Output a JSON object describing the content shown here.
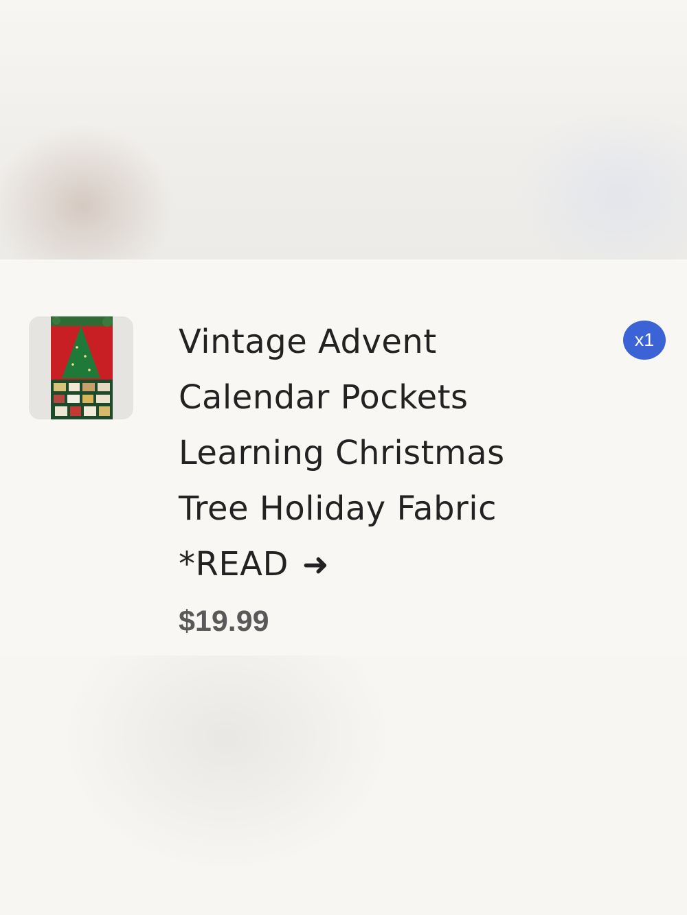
{
  "product": {
    "title": "Vintage Advent\nCalendar Pockets\nLearning Christmas\nTree Holiday Fabric\n*READ",
    "arrow": "➜",
    "price": "$19.99",
    "quantity_badge": "x1",
    "thumbnail_icon": "advent-calendar-thumbnail"
  },
  "colors": {
    "badge": "#3b63d6",
    "title_text": "#222222",
    "price_text": "#595959",
    "background": "#f8f7f4"
  }
}
